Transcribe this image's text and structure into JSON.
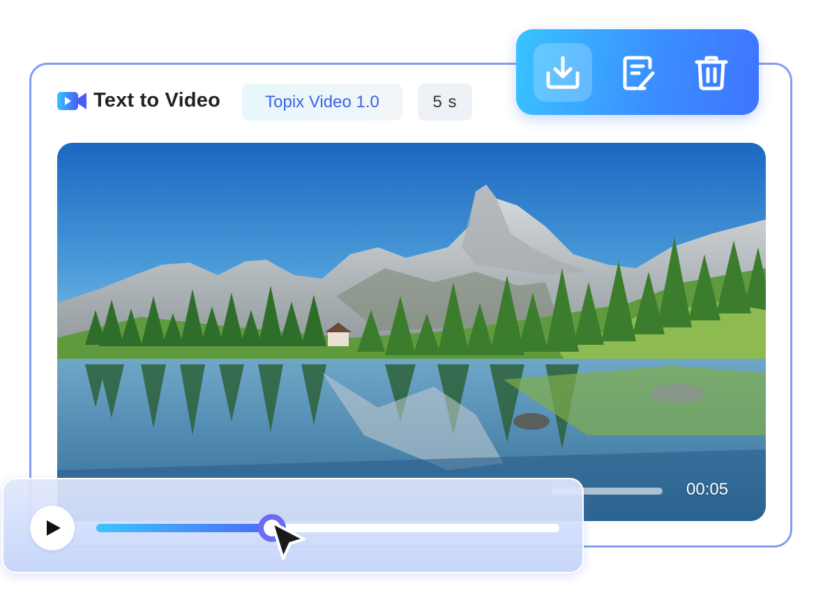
{
  "header": {
    "title": "Text to Video",
    "app_icon": "video-camera-icon"
  },
  "chips": {
    "model": "Topix Video 1.0",
    "duration": "5 s"
  },
  "toolbar": {
    "buttons": [
      {
        "icon": "download-icon",
        "label": "Download"
      },
      {
        "icon": "edit-note-icon",
        "label": "Edit"
      },
      {
        "icon": "trash-icon",
        "label": "Delete"
      }
    ]
  },
  "video": {
    "scene": "mountain lake landscape",
    "time": "00:05"
  },
  "player": {
    "progress": 0.38,
    "play_icon": "play-icon"
  },
  "colors": {
    "accent": "#3f74ff",
    "toolbar_start": "#39c3ff",
    "card_border": "#7f9cf5",
    "model_text": "#3a63e6"
  }
}
